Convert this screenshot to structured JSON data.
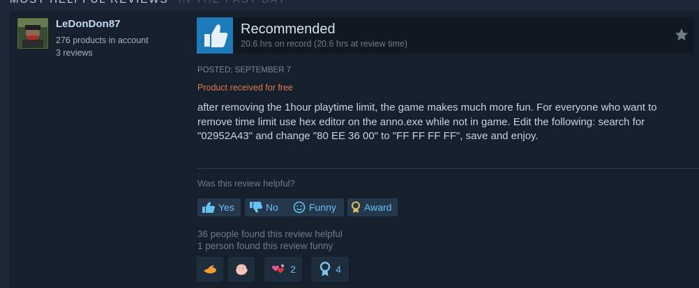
{
  "section": {
    "title": "MOST HELPFUL REVIEWS",
    "subtitle": "IN THE PAST DAY"
  },
  "author": {
    "name": "LeDonDon87",
    "products": "276 products in account",
    "reviews": "3 reviews"
  },
  "review": {
    "verdict": "Recommended",
    "hours": "20.6 hrs on record (20.6 hrs at review time)",
    "posted": "POSTED: SEPTEMBER 7",
    "received_free": "Product received for free",
    "text": "after removing the 1hour playtime limit, the game makes much more fun. For everyone who want to remove time limit use hex editor on the anno.exe while not in game. Edit the following: search for \"02952A43\" and change \"80 EE 36 00\" to \"FF FF FF FF\", save and enjoy."
  },
  "feedback": {
    "question": "Was this review helpful?",
    "yes_label": "Yes",
    "no_label": "No",
    "funny_label": "Funny",
    "award_label": "Award",
    "helpful_count": "36 people found this review helpful",
    "funny_count": "1 person found this review funny"
  },
  "awards": [
    {
      "icon": "hand-icon",
      "count": ""
    },
    {
      "icon": "brain-icon",
      "count": ""
    },
    {
      "icon": "hearts-icon",
      "count": "2"
    },
    {
      "icon": "medal-icon",
      "count": "4"
    }
  ],
  "colors": {
    "background": "#1b2838",
    "card": "#16202d",
    "accent_blue": "#67c1f5",
    "thumb_box": "#1d7bb9",
    "free_text": "#e07b4f"
  }
}
